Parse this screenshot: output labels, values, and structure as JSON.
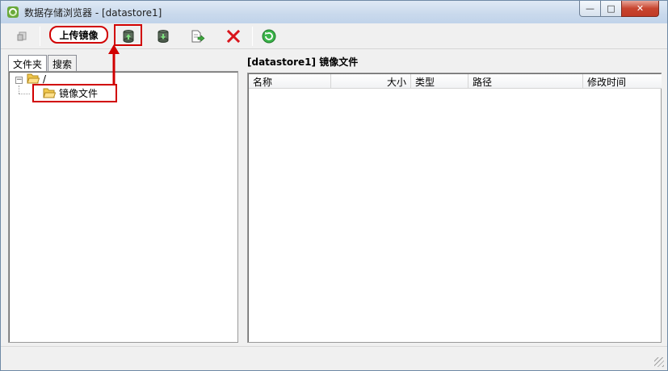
{
  "window": {
    "title": "数据存储浏览器 - [datastore1]",
    "controls": {
      "minimize": "—",
      "maximize": "□",
      "close": "✕"
    }
  },
  "toolbar": {
    "buttons": [
      {
        "name": "parent-folder",
        "icon": "folder-up-icon"
      },
      {
        "name": "upload",
        "icon": "upload-disk-icon",
        "annotation": "上传镜像"
      },
      {
        "name": "download",
        "icon": "download-disk-icon"
      },
      {
        "name": "move",
        "icon": "move-file-icon"
      },
      {
        "name": "delete",
        "icon": "delete-x-icon",
        "color": "#d9141b"
      },
      {
        "name": "refresh",
        "icon": "refresh-icon",
        "color": "#2ea02e"
      }
    ]
  },
  "tabs": [
    {
      "label": "文件夹",
      "active": true
    },
    {
      "label": "搜索",
      "active": false
    }
  ],
  "tree": {
    "root": {
      "label": "/",
      "expanded": true,
      "toggle": "−"
    },
    "children": [
      {
        "label": "镜像文件"
      }
    ]
  },
  "content": {
    "header": "[datastore1] 镜像文件",
    "columns": [
      "名称",
      "大小",
      "类型",
      "路径",
      "修改时间"
    ],
    "rows": []
  },
  "annotations": {
    "callout_text": "上传镜像",
    "color": "#d10000"
  },
  "colors": {
    "accent": "#d10000",
    "window_border": "#6f8aa6"
  }
}
